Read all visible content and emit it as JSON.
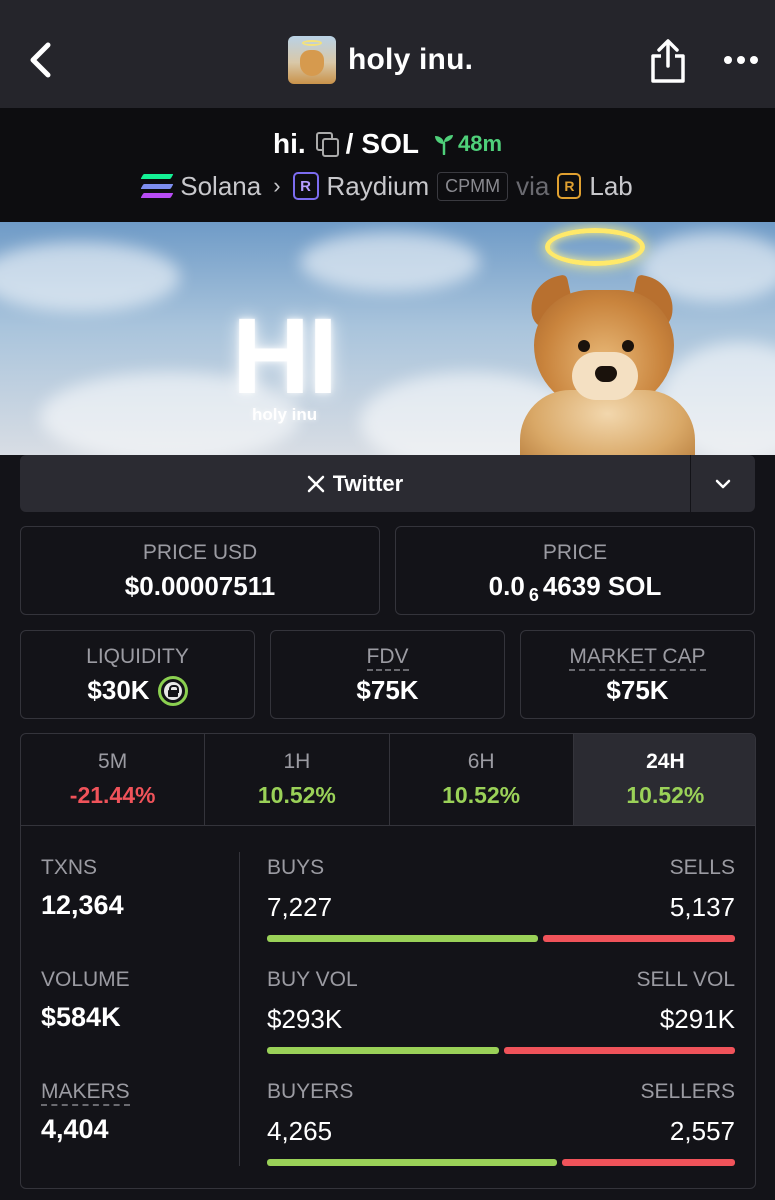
{
  "header": {
    "title": "holy inu.",
    "back_icon": "chevron-left-icon",
    "share_icon": "share-icon",
    "more_icon": "more-dots-icon"
  },
  "pair": {
    "base": "hi.",
    "separator": "/",
    "quote": "SOL",
    "age": "48m",
    "chain": "Solana",
    "dex": "Raydium",
    "pool_type": "CPMM",
    "via": "via",
    "launchpad": "Lab"
  },
  "banner": {
    "big_text": "HI",
    "small_text": "holy inu"
  },
  "social": {
    "twitter_label": "Twitter"
  },
  "prices": {
    "price_usd_label": "PRICE USD",
    "price_usd": "$0.00007511",
    "price_label": "PRICE",
    "price_prefix": "0.0",
    "price_zero_count": "6",
    "price_digits": "4639 SOL"
  },
  "metrics": {
    "liquidity_label": "LIQUIDITY",
    "liquidity": "$30K",
    "fdv_label": "FDV",
    "fdv": "$75K",
    "mcap_label": "MARKET CAP",
    "mcap": "$75K"
  },
  "timeframes": [
    {
      "label": "5M",
      "change": "-21.44%",
      "direction": "down"
    },
    {
      "label": "1H",
      "change": "10.52%",
      "direction": "up"
    },
    {
      "label": "6H",
      "change": "10.52%",
      "direction": "up"
    },
    {
      "label": "24H",
      "change": "10.52%",
      "direction": "up",
      "active": true
    }
  ],
  "stats": {
    "txns_label": "TXNS",
    "txns": "12,364",
    "volume_label": "VOLUME",
    "volume": "$584K",
    "makers_label": "MAKERS",
    "makers": "4,404",
    "buys_label": "BUYS",
    "buys": "7,227",
    "sells_label": "SELLS",
    "sells": "5,137",
    "buy_vol_label": "BUY VOL",
    "buy_vol": "$293K",
    "sell_vol_label": "SELL VOL",
    "sell_vol": "$291K",
    "buyers_label": "BUYERS",
    "buyers": "4,265",
    "sellers_label": "SELLERS",
    "sellers": "2,557"
  },
  "ratios": {
    "buys_fraction": 0.585,
    "buy_vol_fraction": 0.502,
    "buyers_fraction": 0.625
  },
  "colors": {
    "positive": "#9ad158",
    "negative": "#f0535a",
    "age_green": "#4fd07a",
    "background": "#131318"
  }
}
